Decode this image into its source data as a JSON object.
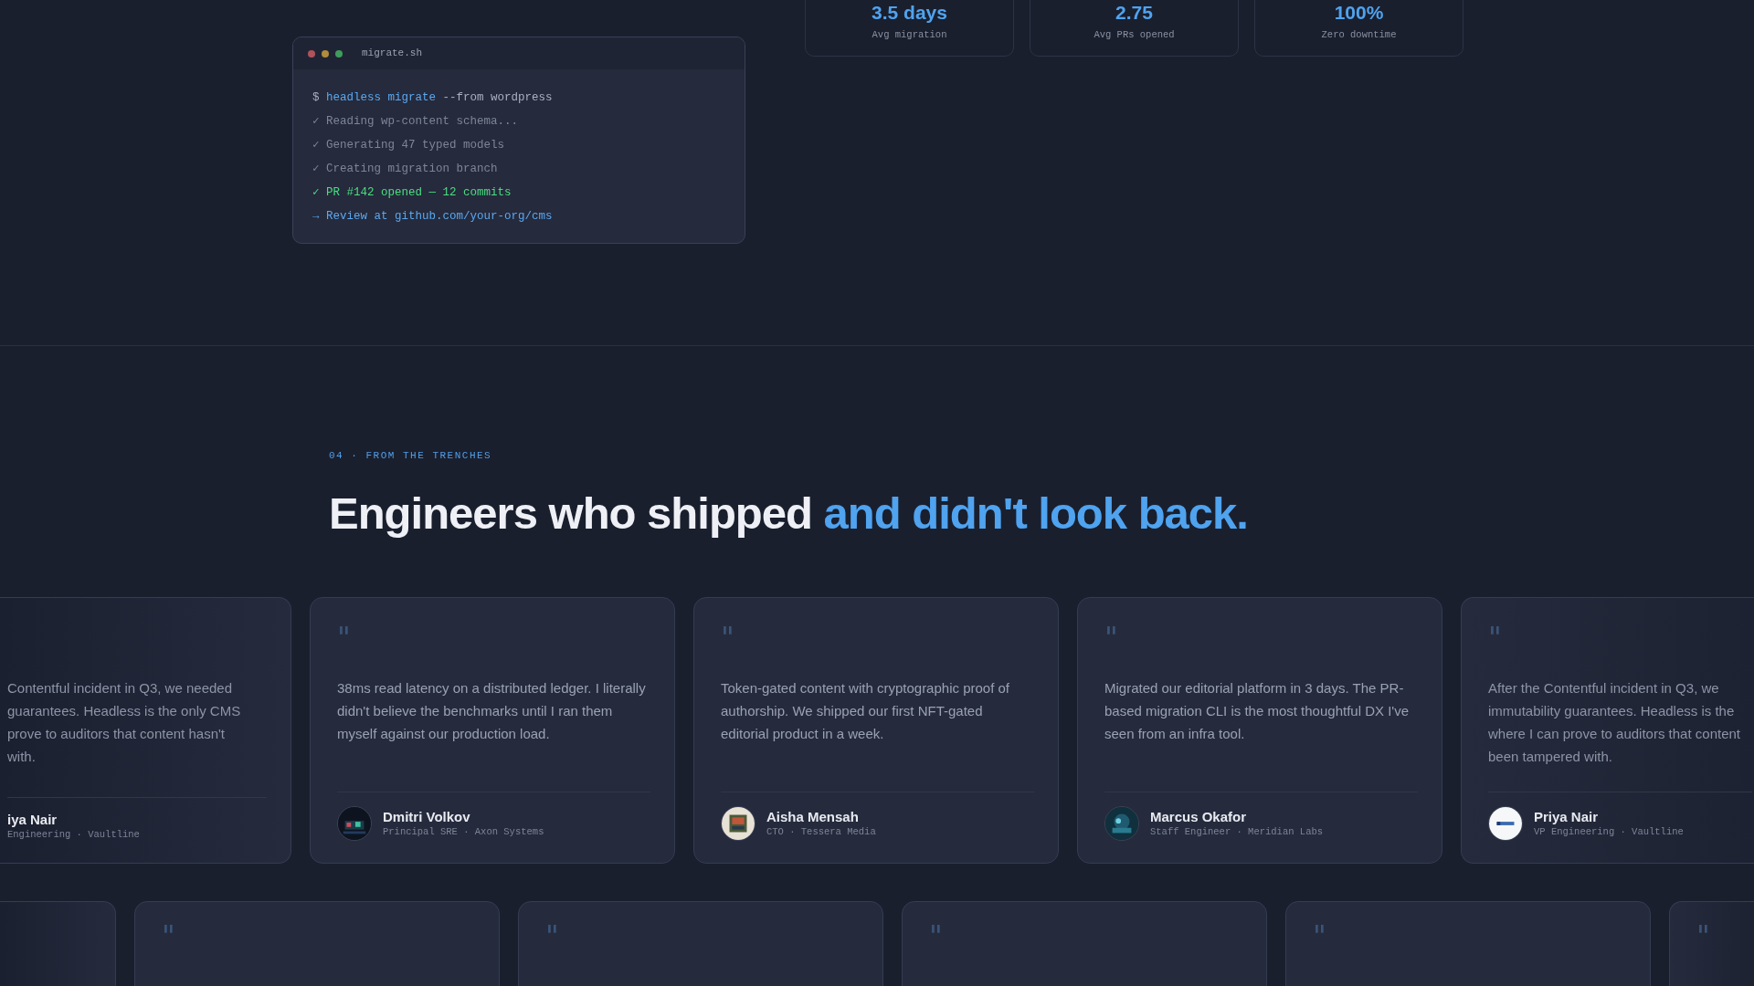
{
  "terminal": {
    "title": "migrate.sh",
    "dots": [
      {
        "color": "#b0525a"
      },
      {
        "color": "#b08c3c"
      },
      {
        "color": "#3f9c5c"
      }
    ],
    "lines": [
      {
        "kind": "command",
        "prompt": "$",
        "command": "headless migrate",
        "args": "--from wordpress"
      },
      {
        "kind": "step",
        "mark": "✓",
        "text": "Reading wp-content schema..."
      },
      {
        "kind": "step",
        "mark": "✓",
        "text": "Generating 47 typed models"
      },
      {
        "kind": "step",
        "mark": "✓",
        "text": "Creating migration branch"
      },
      {
        "kind": "success",
        "mark": "✓",
        "text": "PR #142 opened — 12 commits"
      },
      {
        "kind": "link",
        "mark": "→",
        "text": "Review at github.com/your-org/cms"
      }
    ]
  },
  "stats": [
    {
      "value": "3.5 days",
      "label": "Avg migration"
    },
    {
      "value": "2.75",
      "label": "Avg PRs opened"
    },
    {
      "value": "100%",
      "label": "Zero downtime"
    }
  ],
  "section": {
    "eyebrow": "04 · FROM THE TRENCHES",
    "heading": [
      {
        "text": "Engineers who shipped",
        "accent": false
      },
      {
        "text": "and didn't look back.",
        "accent": true
      }
    ]
  },
  "testimonials": [
    {
      "kind": "clipped_left",
      "lines": [
        "Contentful incident in Q3, we needed",
        "guarantees. Headless is the only CMS",
        "prove to auditors that content hasn't",
        "with."
      ],
      "name": "iya Nair",
      "role": "Engineering · Vaultline"
    },
    {
      "kind": "full",
      "mark": "\"",
      "quote": "38ms read latency on a distributed ledger. I literally didn't believe the benchmarks until I ran them myself against our production load.",
      "name": "Dmitri Volkov",
      "role": "Principal SRE · Axon Systems",
      "avatar": {
        "kind": "picture"
      }
    },
    {
      "kind": "full",
      "mark": "\"",
      "quote": "Token-gated content with cryptographic proof of authorship. We shipped our first NFT-gated editorial product in a week.",
      "name": "Aisha Mensah",
      "role": "CTO · Tessera Media",
      "avatar": {
        "kind": "picture"
      }
    },
    {
      "kind": "full",
      "mark": "\"",
      "quote": "Migrated our editorial platform in 3 days. The PR-based migration CLI is the most thoughtful DX I've seen from an infra tool.",
      "name": "Marcus Okafor",
      "role": "Staff Engineer · Meridian Labs",
      "avatar": {
        "kind": "picture"
      }
    },
    {
      "kind": "clipped_right",
      "mark": "\"",
      "lines": [
        "After the Contentful incident in Q3, we",
        "immutability guarantees. Headless is the",
        "where I can prove to auditors that content",
        "been tampered with."
      ],
      "name": "Priya Nair",
      "role": "VP Engineering · Vaultline",
      "avatar": {
        "kind": "picture"
      }
    }
  ],
  "testimonials_row_2": [
    {
      "kind": "clipped_left"
    },
    {
      "kind": "full",
      "mark": "\""
    },
    {
      "kind": "full",
      "mark": "\""
    },
    {
      "kind": "full",
      "mark": "\""
    },
    {
      "kind": "full",
      "mark": "\""
    },
    {
      "kind": "clipped_right",
      "mark": "\""
    }
  ]
}
